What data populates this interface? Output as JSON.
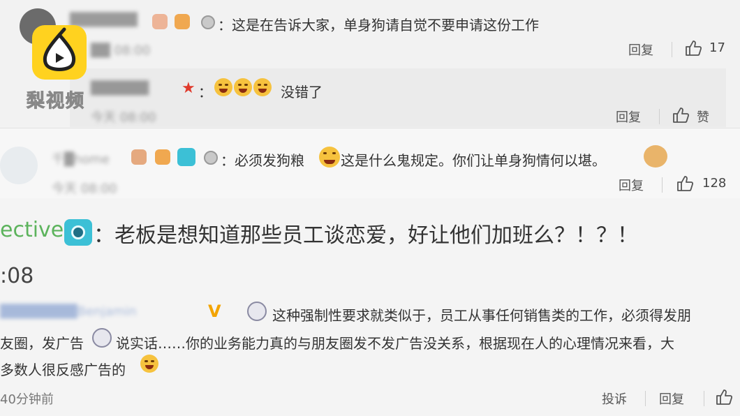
{
  "watermark": {
    "logo_text": "梨视频"
  },
  "comment1": {
    "username": "███████",
    "time": "██ 08:00",
    "text": "：这是在告诉大家，单身狗请自觉不要申请这份工作",
    "reply_label": "回复",
    "likes": "17"
  },
  "reply1": {
    "username": "██████",
    "time": "今天 08:00",
    "text_suffix": "没错了",
    "reply_label": "回复",
    "like_label": "赞"
  },
  "comment2": {
    "username": "千█home",
    "time": "今天 08:00",
    "text_a": "：必须发狗粮",
    "text_b": "这是什么鬼规定。你们让单身狗情何以堪。",
    "reply_label": "回复",
    "likes": "128"
  },
  "comment3": {
    "username_tail": "ective",
    "text": "：老板是想知道那些员工谈恋爱，好让他们加班么？！？！",
    "time_tail": ":08"
  },
  "comment4": {
    "username": "████████Benjamin",
    "verified": "V",
    "line1": "这种强制性要求就类似于，员工从事任何销售类的工作，必须得发朋",
    "line2a": "友圈，发广告",
    "line2b": "说实话……你的业务能力真的与朋友圈发不发广告没关系，根据现在人的心理情况来看，大",
    "line3": "多数人很反感广告的",
    "time": "40分钟前",
    "report_label": "投诉",
    "reply_label": "回复"
  },
  "colors": {
    "camera_badge": "#3cc0d6",
    "logo_yellow": "#ffd21f",
    "verified": "#f3a400"
  }
}
